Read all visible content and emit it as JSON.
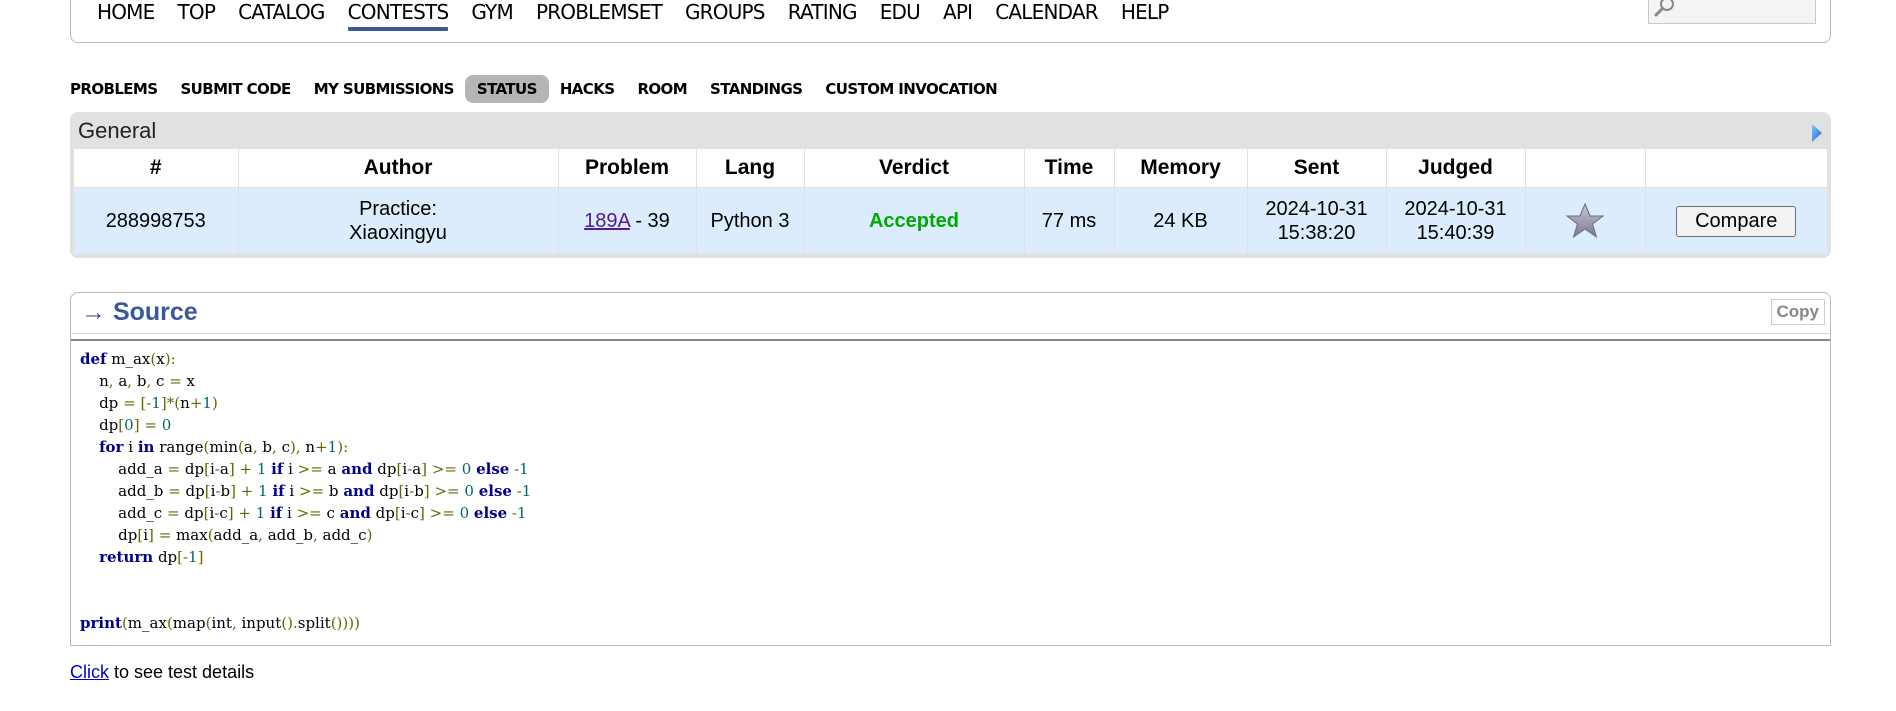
{
  "topnav": {
    "items": [
      "HOME",
      "TOP",
      "CATALOG",
      "CONTESTS",
      "GYM",
      "PROBLEMSET",
      "GROUPS",
      "RATING",
      "EDU",
      "API",
      "CALENDAR",
      "HELP"
    ],
    "active": "CONTESTS",
    "search_icon": "search-icon"
  },
  "contest_menu": {
    "items": [
      "PROBLEMS",
      "SUBMIT CODE",
      "MY SUBMISSIONS",
      "STATUS",
      "HACKS",
      "ROOM",
      "STANDINGS",
      "CUSTOM INVOCATION"
    ],
    "active": "STATUS"
  },
  "general": {
    "title": "General",
    "headers": [
      "#",
      "Author",
      "Problem",
      "Lang",
      "Verdict",
      "Time",
      "Memory",
      "Sent",
      "Judged",
      "",
      ""
    ],
    "row": {
      "id": "288998753",
      "author_line1": "Practice:",
      "author_line2": "Xiaoxingyu",
      "problem_link": "189A",
      "problem_suffix": " - 39",
      "lang": "Python 3",
      "verdict": "Accepted",
      "time": "77 ms",
      "memory": "24 KB",
      "sent_date": "2024-10-31",
      "sent_time": "15:38:20",
      "judged_date": "2024-10-31",
      "judged_time": "15:40:39",
      "compare_label": "Compare"
    },
    "colors": {
      "accepted": "#00aa00",
      "row_bg": "#dcecfc"
    }
  },
  "source": {
    "title": "→ Source",
    "copy_label": "Copy",
    "code": [
      "def m_ax(x):",
      "    n, a, b, c = x",
      "    dp = [-1]*(n+1)",
      "    dp[0] = 0",
      "    for i in range(min(a, b, c), n+1):",
      "        add_a = dp[i-a] + 1 if i >= a and dp[i-a] >= 0 else -1",
      "        add_b = dp[i-b] + 1 if i >= b and dp[i-b] >= 0 else -1",
      "        add_c = dp[i-c] + 1 if i >= c and dp[i-c] >= 0 else -1",
      "        dp[i] = max(add_a, add_b, add_c)",
      "    return dp[-1]",
      "",
      "",
      "print(m_ax(map(int, input().split())))"
    ]
  },
  "footer": {
    "link": "Click",
    "text": " to see test details"
  }
}
